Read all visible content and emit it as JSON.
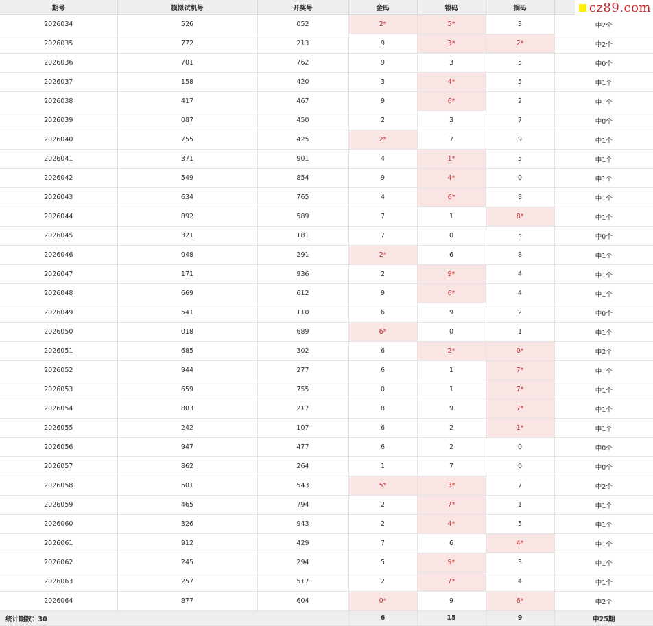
{
  "watermark": {
    "text": "cz89.com",
    "icon": "yellow-square-logo",
    "color": "#c8282f"
  },
  "colors": {
    "hit_bg": "#fae5e5",
    "hit_text": "#c32b2b",
    "header_bg": "#efefef"
  },
  "columns": [
    "期号",
    "模拟试机号",
    "开奖号",
    "金码",
    "银码",
    "铜码",
    ""
  ],
  "rows": [
    {
      "issue": "2026034",
      "trial": "526",
      "draw": "052",
      "gold": {
        "v": "2*",
        "hit": true
      },
      "silver": {
        "v": "5*",
        "hit": true
      },
      "bronze": {
        "v": "3",
        "hit": false
      },
      "result": "中2个"
    },
    {
      "issue": "2026035",
      "trial": "772",
      "draw": "213",
      "gold": {
        "v": "9",
        "hit": false
      },
      "silver": {
        "v": "3*",
        "hit": true
      },
      "bronze": {
        "v": "2*",
        "hit": true
      },
      "result": "中2个"
    },
    {
      "issue": "2026036",
      "trial": "701",
      "draw": "762",
      "gold": {
        "v": "9",
        "hit": false
      },
      "silver": {
        "v": "3",
        "hit": false
      },
      "bronze": {
        "v": "5",
        "hit": false
      },
      "result": "中0个"
    },
    {
      "issue": "2026037",
      "trial": "158",
      "draw": "420",
      "gold": {
        "v": "3",
        "hit": false
      },
      "silver": {
        "v": "4*",
        "hit": true
      },
      "bronze": {
        "v": "5",
        "hit": false
      },
      "result": "中1个"
    },
    {
      "issue": "2026038",
      "trial": "417",
      "draw": "467",
      "gold": {
        "v": "9",
        "hit": false
      },
      "silver": {
        "v": "6*",
        "hit": true
      },
      "bronze": {
        "v": "2",
        "hit": false
      },
      "result": "中1个"
    },
    {
      "issue": "2026039",
      "trial": "087",
      "draw": "450",
      "gold": {
        "v": "2",
        "hit": false
      },
      "silver": {
        "v": "3",
        "hit": false
      },
      "bronze": {
        "v": "7",
        "hit": false
      },
      "result": "中0个"
    },
    {
      "issue": "2026040",
      "trial": "755",
      "draw": "425",
      "gold": {
        "v": "2*",
        "hit": true
      },
      "silver": {
        "v": "7",
        "hit": false
      },
      "bronze": {
        "v": "9",
        "hit": false
      },
      "result": "中1个"
    },
    {
      "issue": "2026041",
      "trial": "371",
      "draw": "901",
      "gold": {
        "v": "4",
        "hit": false
      },
      "silver": {
        "v": "1*",
        "hit": true
      },
      "bronze": {
        "v": "5",
        "hit": false
      },
      "result": "中1个"
    },
    {
      "issue": "2026042",
      "trial": "549",
      "draw": "854",
      "gold": {
        "v": "9",
        "hit": false
      },
      "silver": {
        "v": "4*",
        "hit": true
      },
      "bronze": {
        "v": "0",
        "hit": false
      },
      "result": "中1个"
    },
    {
      "issue": "2026043",
      "trial": "634",
      "draw": "765",
      "gold": {
        "v": "4",
        "hit": false
      },
      "silver": {
        "v": "6*",
        "hit": true
      },
      "bronze": {
        "v": "8",
        "hit": false
      },
      "result": "中1个"
    },
    {
      "issue": "2026044",
      "trial": "892",
      "draw": "589",
      "gold": {
        "v": "7",
        "hit": false
      },
      "silver": {
        "v": "1",
        "hit": false
      },
      "bronze": {
        "v": "8*",
        "hit": true
      },
      "result": "中1个"
    },
    {
      "issue": "2026045",
      "trial": "321",
      "draw": "181",
      "gold": {
        "v": "7",
        "hit": false
      },
      "silver": {
        "v": "0",
        "hit": false
      },
      "bronze": {
        "v": "5",
        "hit": false
      },
      "result": "中0个"
    },
    {
      "issue": "2026046",
      "trial": "048",
      "draw": "291",
      "gold": {
        "v": "2*",
        "hit": true
      },
      "silver": {
        "v": "6",
        "hit": false
      },
      "bronze": {
        "v": "8",
        "hit": false
      },
      "result": "中1个"
    },
    {
      "issue": "2026047",
      "trial": "171",
      "draw": "936",
      "gold": {
        "v": "2",
        "hit": false
      },
      "silver": {
        "v": "9*",
        "hit": true
      },
      "bronze": {
        "v": "4",
        "hit": false
      },
      "result": "中1个"
    },
    {
      "issue": "2026048",
      "trial": "669",
      "draw": "612",
      "gold": {
        "v": "9",
        "hit": false
      },
      "silver": {
        "v": "6*",
        "hit": true
      },
      "bronze": {
        "v": "4",
        "hit": false
      },
      "result": "中1个"
    },
    {
      "issue": "2026049",
      "trial": "541",
      "draw": "110",
      "gold": {
        "v": "6",
        "hit": false
      },
      "silver": {
        "v": "9",
        "hit": false
      },
      "bronze": {
        "v": "2",
        "hit": false
      },
      "result": "中0个"
    },
    {
      "issue": "2026050",
      "trial": "018",
      "draw": "689",
      "gold": {
        "v": "6*",
        "hit": true
      },
      "silver": {
        "v": "0",
        "hit": false
      },
      "bronze": {
        "v": "1",
        "hit": false
      },
      "result": "中1个"
    },
    {
      "issue": "2026051",
      "trial": "685",
      "draw": "302",
      "gold": {
        "v": "6",
        "hit": false
      },
      "silver": {
        "v": "2*",
        "hit": true
      },
      "bronze": {
        "v": "0*",
        "hit": true
      },
      "result": "中2个"
    },
    {
      "issue": "2026052",
      "trial": "944",
      "draw": "277",
      "gold": {
        "v": "6",
        "hit": false
      },
      "silver": {
        "v": "1",
        "hit": false
      },
      "bronze": {
        "v": "7*",
        "hit": true
      },
      "result": "中1个"
    },
    {
      "issue": "2026053",
      "trial": "659",
      "draw": "755",
      "gold": {
        "v": "0",
        "hit": false
      },
      "silver": {
        "v": "1",
        "hit": false
      },
      "bronze": {
        "v": "7*",
        "hit": true
      },
      "result": "中1个"
    },
    {
      "issue": "2026054",
      "trial": "803",
      "draw": "217",
      "gold": {
        "v": "8",
        "hit": false
      },
      "silver": {
        "v": "9",
        "hit": false
      },
      "bronze": {
        "v": "7*",
        "hit": true
      },
      "result": "中1个"
    },
    {
      "issue": "2026055",
      "trial": "242",
      "draw": "107",
      "gold": {
        "v": "6",
        "hit": false
      },
      "silver": {
        "v": "2",
        "hit": false
      },
      "bronze": {
        "v": "1*",
        "hit": true
      },
      "result": "中1个"
    },
    {
      "issue": "2026056",
      "trial": "947",
      "draw": "477",
      "gold": {
        "v": "6",
        "hit": false
      },
      "silver": {
        "v": "2",
        "hit": false
      },
      "bronze": {
        "v": "0",
        "hit": false
      },
      "result": "中0个"
    },
    {
      "issue": "2026057",
      "trial": "862",
      "draw": "264",
      "gold": {
        "v": "1",
        "hit": false
      },
      "silver": {
        "v": "7",
        "hit": false
      },
      "bronze": {
        "v": "0",
        "hit": false
      },
      "result": "中0个"
    },
    {
      "issue": "2026058",
      "trial": "601",
      "draw": "543",
      "gold": {
        "v": "5*",
        "hit": true
      },
      "silver": {
        "v": "3*",
        "hit": true
      },
      "bronze": {
        "v": "7",
        "hit": false
      },
      "result": "中2个"
    },
    {
      "issue": "2026059",
      "trial": "465",
      "draw": "794",
      "gold": {
        "v": "2",
        "hit": false
      },
      "silver": {
        "v": "7*",
        "hit": true
      },
      "bronze": {
        "v": "1",
        "hit": false
      },
      "result": "中1个"
    },
    {
      "issue": "2026060",
      "trial": "326",
      "draw": "943",
      "gold": {
        "v": "2",
        "hit": false
      },
      "silver": {
        "v": "4*",
        "hit": true
      },
      "bronze": {
        "v": "5",
        "hit": false
      },
      "result": "中1个"
    },
    {
      "issue": "2026061",
      "trial": "912",
      "draw": "429",
      "gold": {
        "v": "7",
        "hit": false
      },
      "silver": {
        "v": "6",
        "hit": false
      },
      "bronze": {
        "v": "4*",
        "hit": true
      },
      "result": "中1个"
    },
    {
      "issue": "2026062",
      "trial": "245",
      "draw": "294",
      "gold": {
        "v": "5",
        "hit": false
      },
      "silver": {
        "v": "9*",
        "hit": true
      },
      "bronze": {
        "v": "3",
        "hit": false
      },
      "result": "中1个"
    },
    {
      "issue": "2026063",
      "trial": "257",
      "draw": "517",
      "gold": {
        "v": "2",
        "hit": false
      },
      "silver": {
        "v": "7*",
        "hit": true
      },
      "bronze": {
        "v": "4",
        "hit": false
      },
      "result": "中1个"
    },
    {
      "issue": "2026064",
      "trial": "877",
      "draw": "604",
      "gold": {
        "v": "0*",
        "hit": true
      },
      "silver": {
        "v": "9",
        "hit": false
      },
      "bronze": {
        "v": "6*",
        "hit": true
      },
      "result": "中2个"
    }
  ],
  "footer": {
    "label": "统计期数：30",
    "gold": "6",
    "silver": "15",
    "bronze": "9",
    "result": "中25期"
  }
}
